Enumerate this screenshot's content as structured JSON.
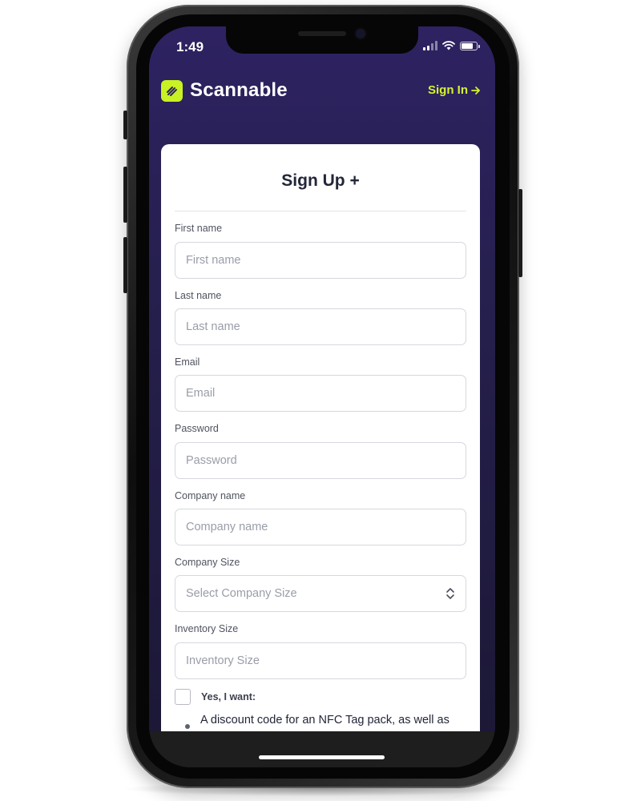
{
  "status_bar": {
    "time": "1:49",
    "battery_level": 0.85
  },
  "header": {
    "brand": "Scannable",
    "sign_in": "Sign In"
  },
  "form": {
    "title": "Sign Up +",
    "fields": [
      {
        "label": "First name",
        "placeholder": "First name"
      },
      {
        "label": "Last name",
        "placeholder": "Last name"
      },
      {
        "label": "Email",
        "placeholder": "Email"
      },
      {
        "label": "Password",
        "placeholder": "Password"
      },
      {
        "label": "Company name",
        "placeholder": "Company name"
      },
      {
        "label": "Company Size",
        "placeholder": "Select Company Size"
      },
      {
        "label": "Inventory Size",
        "placeholder": "Inventory Size"
      }
    ],
    "opt_in_label": "Yes, I want:",
    "opt_in_items": [
      "A discount code for an NFC Tag pack, as well as"
    ]
  },
  "colors": {
    "accent": "#c8f223",
    "header_bg": "#2e2262",
    "link": "#d6f230"
  }
}
